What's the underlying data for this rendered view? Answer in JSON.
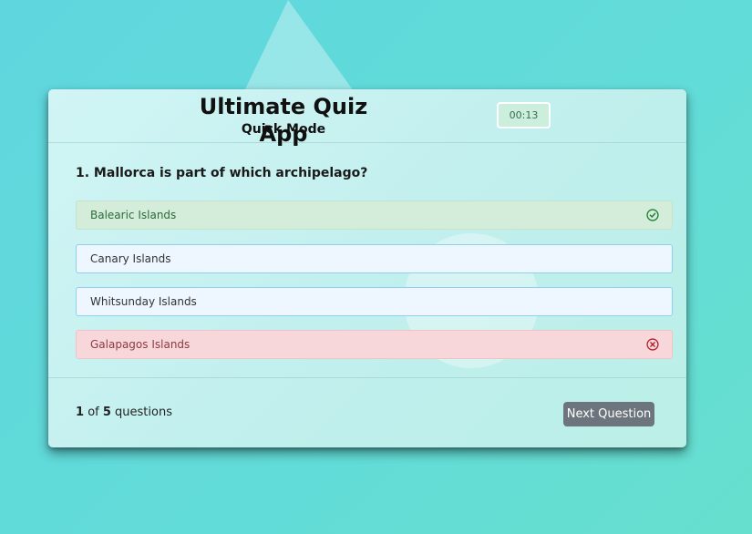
{
  "app": {
    "title": "Ultimate Quiz App",
    "subtitle": "Quick Mode",
    "timer": "00:13"
  },
  "question": {
    "text": "1. Mallorca is part of which archipelago?"
  },
  "answers": [
    {
      "label": "Balearic Islands",
      "state": "correct",
      "icon": "check-circle-icon"
    },
    {
      "label": "Canary Islands",
      "state": "neutral"
    },
    {
      "label": "Whitsunday Islands",
      "state": "neutral"
    },
    {
      "label": "Galapagos Islands",
      "state": "wrong",
      "icon": "x-circle-icon"
    }
  ],
  "footer": {
    "current": "1",
    "of_text": "of",
    "total": "5",
    "suffix": "questions",
    "next_label": "Next Question"
  },
  "colors": {
    "correct": "#d4ecda",
    "wrong": "#f8d7da",
    "neutral": "#eef6ff",
    "button": "#6c757d"
  }
}
